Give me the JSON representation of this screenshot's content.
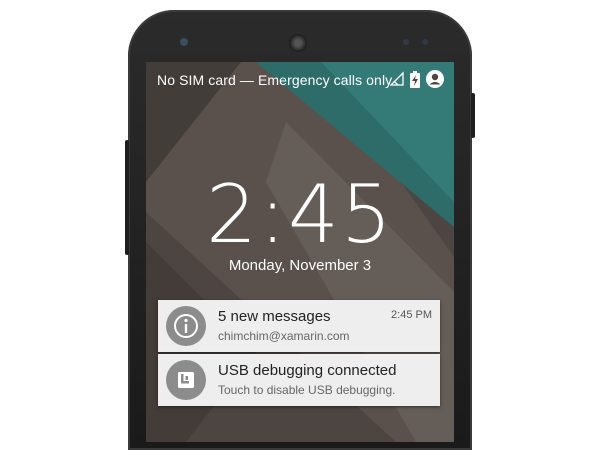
{
  "status_bar": {
    "carrier_text": "No SIM card — Emergency calls only",
    "icons": [
      "no-signal-icon",
      "battery-charging-icon",
      "user-account-icon"
    ]
  },
  "lockscreen": {
    "time": "2:45",
    "date": "Monday, November 3"
  },
  "notifications": [
    {
      "icon": "info-icon",
      "title": "5 new messages",
      "subtitle": "chimchim@xamarin.com",
      "time": "2:45 PM"
    },
    {
      "icon": "usb-debug-icon",
      "title": "USB debugging connected",
      "subtitle": "Touch to disable USB debugging."
    }
  ],
  "colors": {
    "wallpaper_teal": "#2d6c69",
    "wallpaper_dark": "#4a4440",
    "card_background": "#eeeeee"
  }
}
